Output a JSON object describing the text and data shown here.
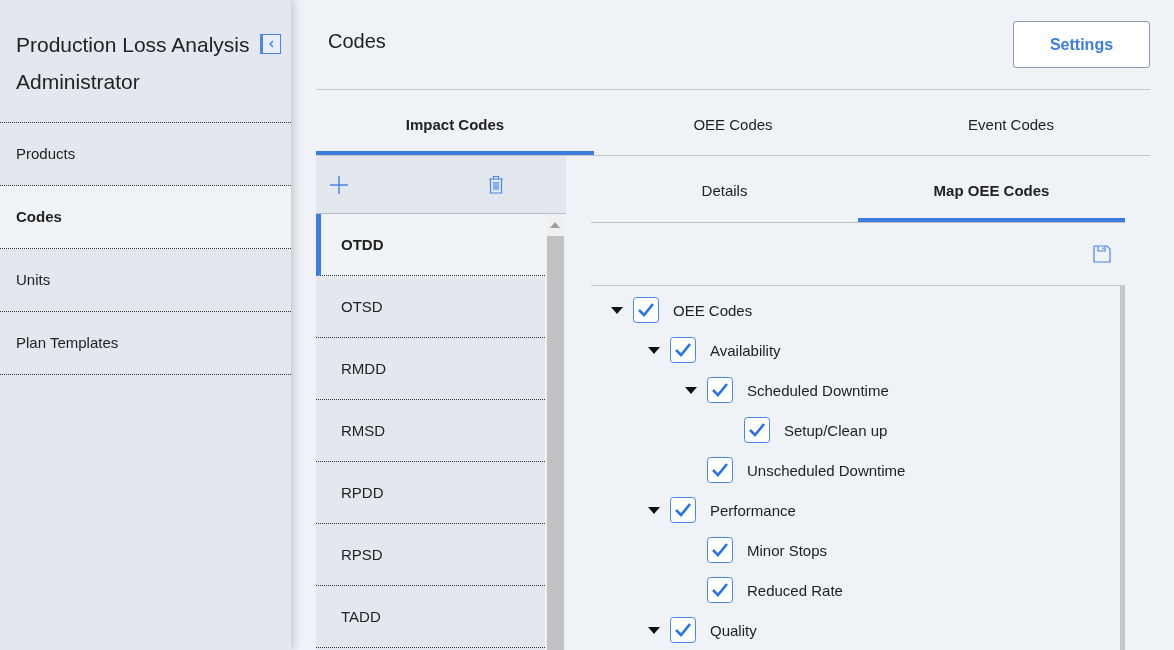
{
  "sidebar": {
    "title": "Production Loss Analysis Administrator",
    "items": [
      {
        "label": "Products",
        "selected": false
      },
      {
        "label": "Codes",
        "selected": true
      },
      {
        "label": "Units",
        "selected": false
      },
      {
        "label": "Plan Templates",
        "selected": false
      }
    ]
  },
  "header": {
    "title": "Codes",
    "button": "Settings"
  },
  "tabs": [
    {
      "label": "Impact Codes",
      "selected": true
    },
    {
      "label": "OEE Codes",
      "selected": false
    },
    {
      "label": "Event Codes",
      "selected": false
    }
  ],
  "codes": [
    {
      "label": "OTDD",
      "selected": true
    },
    {
      "label": "OTSD",
      "selected": false
    },
    {
      "label": "RMDD",
      "selected": false
    },
    {
      "label": "RMSD",
      "selected": false
    },
    {
      "label": "RPDD",
      "selected": false
    },
    {
      "label": "RPSD",
      "selected": false
    },
    {
      "label": "TADD",
      "selected": false
    }
  ],
  "detail_tabs": [
    {
      "label": "Details",
      "selected": false
    },
    {
      "label": "Map OEE Codes",
      "selected": true
    }
  ],
  "tree": [
    {
      "label": "OEE Codes",
      "checked": true,
      "expanded": true,
      "children": [
        {
          "label": "Availability",
          "checked": true,
          "expanded": true,
          "children": [
            {
              "label": "Scheduled Downtime",
              "checked": true,
              "expanded": true,
              "children": [
                {
                  "label": "Setup/Clean up",
                  "checked": true
                }
              ]
            },
            {
              "label": "Unscheduled Downtime",
              "checked": true
            }
          ]
        },
        {
          "label": "Performance",
          "checked": true,
          "expanded": true,
          "children": [
            {
              "label": "Minor Stops",
              "checked": true
            },
            {
              "label": "Reduced Rate",
              "checked": true
            }
          ]
        },
        {
          "label": "Quality",
          "checked": true,
          "expanded": true
        }
      ]
    }
  ]
}
